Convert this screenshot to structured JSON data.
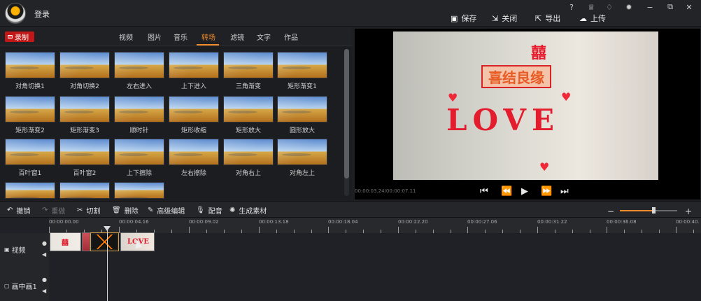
{
  "app": {
    "login": "登录"
  },
  "window_controls": [
    "?",
    "♕",
    "♢",
    "✹",
    "−",
    "⧉",
    "✕"
  ],
  "header_actions": [
    {
      "label": "保存",
      "icon": "save-icon"
    },
    {
      "label": "关闭",
      "icon": "exit-icon"
    },
    {
      "label": "导出",
      "icon": "export-icon"
    },
    {
      "label": "上传",
      "icon": "cloud-upload-icon"
    }
  ],
  "media": {
    "record": "录制",
    "tabs": [
      "视频",
      "图片",
      "音乐",
      "转场",
      "滤镜",
      "文字",
      "作品"
    ],
    "active_tab": "转场",
    "transitions": [
      "对角切换1",
      "对角切换2",
      "左右进入",
      "上下进入",
      "三角渐变",
      "矩形渐变1",
      "矩形渐变2",
      "矩形渐变3",
      "顺时针",
      "矩形收缩",
      "矩形放大",
      "圆形放大",
      "百叶窗1",
      "百叶窗2",
      "上下擦除",
      "左右擦除",
      "对角右上",
      "对角左上",
      "",
      "",
      ""
    ]
  },
  "preview": {
    "timecode": "00:00:03.24/00:00:07.11",
    "love_text": "LOVE",
    "chinese_text": "喜结良缘",
    "double_happiness": "囍"
  },
  "edit_toolbar": {
    "undo": "撤销",
    "redo": "重做",
    "cut": "切割",
    "delete": "删除",
    "advanced": "高级编辑",
    "dub": "配音",
    "generate": "生成素材",
    "zoom": {
      "minus": "−",
      "plus": "+"
    }
  },
  "timeline": {
    "times": [
      "00:00:00.00",
      "00:00:04.16",
      "00:00:09.02",
      "00:00:13.18",
      "00:00:18.04",
      "00:00:22.20",
      "00:00:27.06",
      "00:00:31.22",
      "00:00:36.08",
      "00:00:40."
    ],
    "tracks": [
      {
        "label": "视频",
        "icon": "video-track-icon"
      },
      {
        "label": "画中画1",
        "icon": "picture-in-picture-icon"
      }
    ],
    "clip_texts": {
      "clip1": "囍",
      "clip4": "LOVE"
    }
  }
}
